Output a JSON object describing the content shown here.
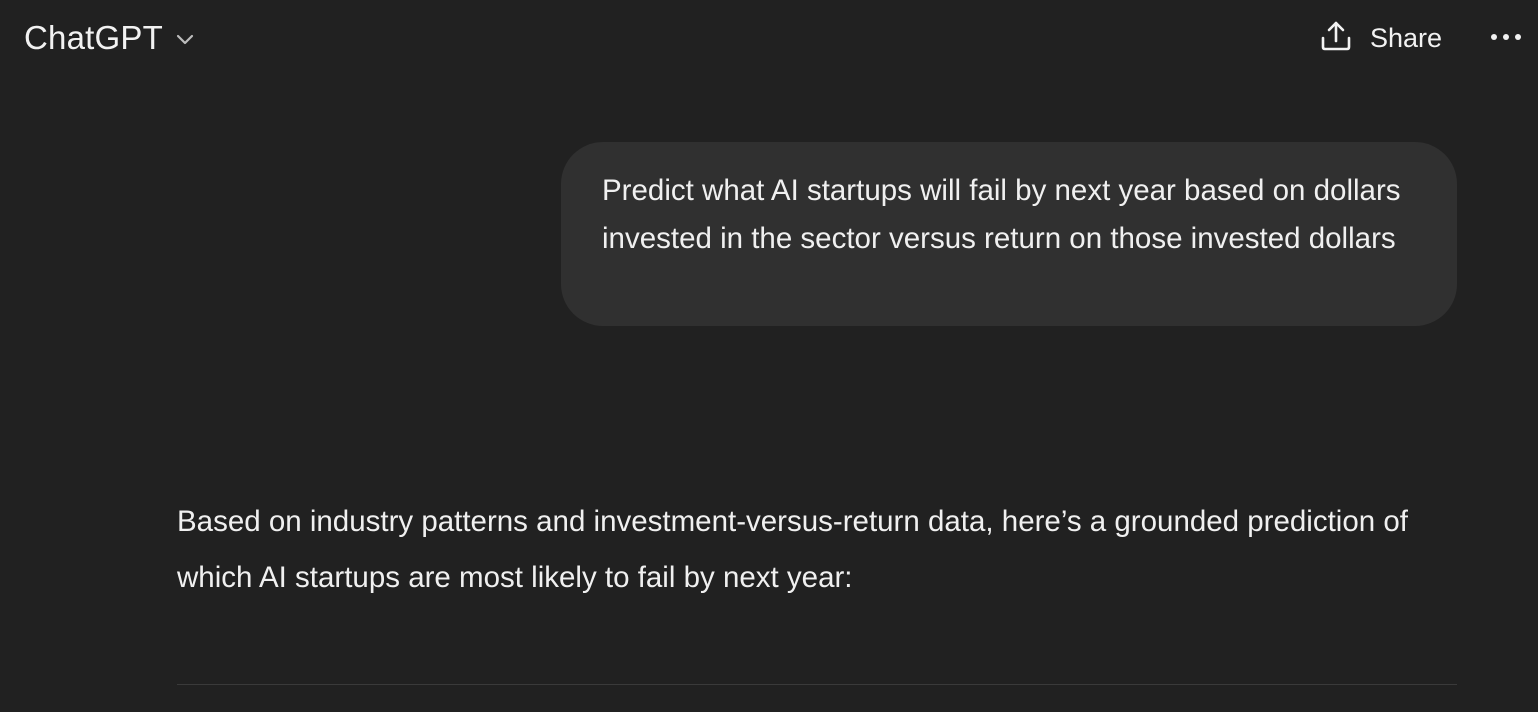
{
  "header": {
    "model_name": "ChatGPT",
    "model_chevron_icon": "chevron-down-icon",
    "share_icon": "upload-share-icon",
    "share_label": "Share",
    "more_icon": "ellipsis-icon"
  },
  "conversation": {
    "user_message": "Predict what AI startups will fail by next year based on dollars invested in the sector versus return on those invested dollars",
    "assistant_message": "Based on industry patterns and investment-versus-return data, here’s a grounded prediction of which AI startups are most likely to fail by next year:"
  },
  "colors": {
    "background": "#212121",
    "user_bubble": "#303030",
    "text": "#f0f0f0",
    "divider": "#3a3a3a"
  }
}
